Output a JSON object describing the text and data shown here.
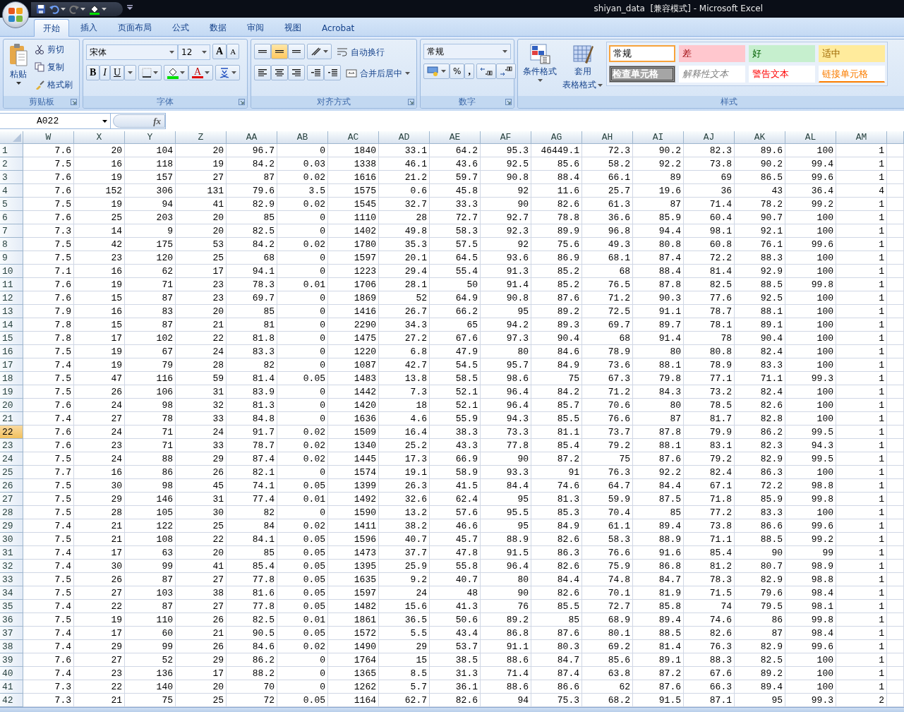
{
  "window": {
    "title": "shiyan_data  [兼容模式] - Microsoft Excel"
  },
  "ribbon_tabs": [
    {
      "label": "开始",
      "selected": true
    },
    {
      "label": "插入",
      "selected": false
    },
    {
      "label": "页面布局",
      "selected": false
    },
    {
      "label": "公式",
      "selected": false
    },
    {
      "label": "数据",
      "selected": false
    },
    {
      "label": "审阅",
      "selected": false
    },
    {
      "label": "视图",
      "selected": false
    },
    {
      "label": "Acrobat",
      "selected": false
    }
  ],
  "ribbon": {
    "clipboard": {
      "title": "剪贴板",
      "paste": "粘贴",
      "items": [
        "剪切",
        "复制",
        "格式刷"
      ]
    },
    "font": {
      "title": "字体",
      "font_name": "宋体",
      "font_size": "12",
      "grow": "A",
      "shrink": "A",
      "styles": [
        "B",
        "I",
        "U"
      ],
      "color_letter": "A"
    },
    "alignment": {
      "title": "对齐方式",
      "wrap": "自动换行",
      "merge": "合并后居中"
    },
    "number": {
      "title": "数字",
      "format": "常规",
      "percent": "%",
      "comma": ","
    },
    "styles": {
      "title": "样式",
      "conditional": "条件格式",
      "table_format": [
        "套用",
        "表格格式"
      ],
      "cell_styles": [
        {
          "label": "常规",
          "kind": "normal",
          "selected": true
        },
        {
          "label": "差",
          "kind": "bad",
          "selected": false
        },
        {
          "label": "好",
          "kind": "good",
          "selected": false
        },
        {
          "label": "适中",
          "kind": "neutral",
          "selected": false
        },
        {
          "label": "检查单元格",
          "kind": "check",
          "selected": false
        },
        {
          "label": "解释性文本",
          "kind": "explanatory",
          "selected": false
        },
        {
          "label": "警告文本",
          "kind": "warning",
          "selected": false
        },
        {
          "label": "链接单元格",
          "kind": "linked",
          "selected": false
        }
      ]
    }
  },
  "formula_bar": {
    "name_box": "A022",
    "fx": "fx"
  },
  "grid": {
    "columns": [
      "W",
      "X",
      "Y",
      "Z",
      "AA",
      "AB",
      "AC",
      "AD",
      "AE",
      "AF",
      "AG",
      "AH",
      "AI",
      "AJ",
      "AK",
      "AL",
      "AM"
    ],
    "rows": [
      {
        "header": "1",
        "selected": false,
        "cells": [
          "7.6",
          "20",
          "104",
          "20",
          "96.7",
          "0",
          "1840",
          "33.1",
          "64.2",
          "95.3",
          "46449.1",
          "72.3",
          "90.2",
          "82.3",
          "89.6",
          "100",
          "1"
        ]
      },
      {
        "header": "2",
        "selected": false,
        "cells": [
          "7.5",
          "16",
          "118",
          "19",
          "84.2",
          "0.03",
          "1338",
          "46.1",
          "43.6",
          "92.5",
          "85.6",
          "58.2",
          "92.2",
          "73.8",
          "90.2",
          "99.4",
          "1"
        ]
      },
      {
        "header": "3",
        "selected": false,
        "cells": [
          "7.6",
          "19",
          "157",
          "27",
          "87",
          "0.02",
          "1616",
          "21.2",
          "59.7",
          "90.8",
          "88.4",
          "66.1",
          "89",
          "69",
          "86.5",
          "99.6",
          "1"
        ]
      },
      {
        "header": "4",
        "selected": false,
        "cells": [
          "7.6",
          "152",
          "306",
          "131",
          "79.6",
          "3.5",
          "1575",
          "0.6",
          "45.8",
          "92",
          "11.6",
          "25.7",
          "19.6",
          "36",
          "43",
          "36.4",
          "4"
        ]
      },
      {
        "header": "5",
        "selected": false,
        "cells": [
          "7.5",
          "19",
          "94",
          "41",
          "82.9",
          "0.02",
          "1545",
          "32.7",
          "33.3",
          "90",
          "82.6",
          "61.3",
          "87",
          "71.4",
          "78.2",
          "99.2",
          "1"
        ]
      },
      {
        "header": "6",
        "selected": false,
        "cells": [
          "7.6",
          "25",
          "203",
          "20",
          "85",
          "0",
          "1110",
          "28",
          "72.7",
          "92.7",
          "78.8",
          "36.6",
          "85.9",
          "60.4",
          "90.7",
          "100",
          "1"
        ]
      },
      {
        "header": "7",
        "selected": false,
        "cells": [
          "7.3",
          "14",
          "9",
          "20",
          "82.5",
          "0",
          "1402",
          "49.8",
          "58.3",
          "92.3",
          "89.9",
          "96.8",
          "94.4",
          "98.1",
          "92.1",
          "100",
          "1"
        ]
      },
      {
        "header": "8",
        "selected": false,
        "cells": [
          "7.5",
          "42",
          "175",
          "53",
          "84.2",
          "0.02",
          "1780",
          "35.3",
          "57.5",
          "92",
          "75.6",
          "49.3",
          "80.8",
          "60.8",
          "76.1",
          "99.6",
          "1"
        ]
      },
      {
        "header": "9",
        "selected": false,
        "cells": [
          "7.5",
          "23",
          "120",
          "25",
          "68",
          "0",
          "1597",
          "20.1",
          "64.5",
          "93.6",
          "86.9",
          "68.1",
          "87.4",
          "72.2",
          "88.3",
          "100",
          "1"
        ]
      },
      {
        "header": "10",
        "selected": false,
        "cells": [
          "7.1",
          "16",
          "62",
          "17",
          "94.1",
          "0",
          "1223",
          "29.4",
          "55.4",
          "91.3",
          "85.2",
          "68",
          "88.4",
          "81.4",
          "92.9",
          "100",
          "1"
        ]
      },
      {
        "header": "11",
        "selected": false,
        "cells": [
          "7.6",
          "19",
          "71",
          "23",
          "78.3",
          "0.01",
          "1706",
          "28.1",
          "50",
          "91.4",
          "85.2",
          "76.5",
          "87.8",
          "82.5",
          "88.5",
          "99.8",
          "1"
        ]
      },
      {
        "header": "12",
        "selected": false,
        "cells": [
          "7.6",
          "15",
          "87",
          "23",
          "69.7",
          "0",
          "1869",
          "52",
          "64.9",
          "90.8",
          "87.6",
          "71.2",
          "90.3",
          "77.6",
          "92.5",
          "100",
          "1"
        ]
      },
      {
        "header": "13",
        "selected": false,
        "cells": [
          "7.9",
          "16",
          "83",
          "20",
          "85",
          "0",
          "1416",
          "26.7",
          "66.2",
          "95",
          "89.2",
          "72.5",
          "91.1",
          "78.7",
          "88.1",
          "100",
          "1"
        ]
      },
      {
        "header": "14",
        "selected": false,
        "cells": [
          "7.8",
          "15",
          "87",
          "21",
          "81",
          "0",
          "2290",
          "34.3",
          "65",
          "94.2",
          "89.3",
          "69.7",
          "89.7",
          "78.1",
          "89.1",
          "100",
          "1"
        ]
      },
      {
        "header": "15",
        "selected": false,
        "cells": [
          "7.8",
          "17",
          "102",
          "22",
          "81.8",
          "0",
          "1475",
          "27.2",
          "67.6",
          "97.3",
          "90.4",
          "68",
          "91.4",
          "78",
          "90.4",
          "100",
          "1"
        ]
      },
      {
        "header": "16",
        "selected": false,
        "cells": [
          "7.5",
          "19",
          "67",
          "24",
          "83.3",
          "0",
          "1220",
          "6.8",
          "47.9",
          "80",
          "84.6",
          "78.9",
          "80",
          "80.8",
          "82.4",
          "100",
          "1"
        ]
      },
      {
        "header": "17",
        "selected": false,
        "cells": [
          "7.4",
          "19",
          "79",
          "28",
          "82",
          "0",
          "1087",
          "42.7",
          "54.5",
          "95.7",
          "84.9",
          "73.6",
          "88.1",
          "78.9",
          "83.3",
          "100",
          "1"
        ]
      },
      {
        "header": "18",
        "selected": false,
        "cells": [
          "7.5",
          "47",
          "116",
          "59",
          "81.4",
          "0.05",
          "1483",
          "13.8",
          "58.5",
          "98.6",
          "75",
          "67.3",
          "79.8",
          "77.1",
          "71.1",
          "99.3",
          "1"
        ]
      },
      {
        "header": "19",
        "selected": false,
        "cells": [
          "7.5",
          "26",
          "106",
          "31",
          "83.9",
          "0",
          "1442",
          "7.3",
          "52.1",
          "96.4",
          "84.2",
          "71.2",
          "84.3",
          "73.2",
          "82.4",
          "100",
          "1"
        ]
      },
      {
        "header": "20",
        "selected": false,
        "cells": [
          "7.6",
          "24",
          "98",
          "32",
          "81.3",
          "0",
          "1420",
          "18",
          "52.1",
          "96.4",
          "85.7",
          "70.6",
          "80",
          "78.5",
          "82.6",
          "100",
          "1"
        ]
      },
      {
        "header": "21",
        "selected": false,
        "cells": [
          "7.4",
          "27",
          "78",
          "33",
          "84.8",
          "0",
          "1636",
          "4.6",
          "55.9",
          "94.3",
          "85.5",
          "76.6",
          "87",
          "81.7",
          "82.8",
          "100",
          "1"
        ]
      },
      {
        "header": "22",
        "selected": true,
        "cells": [
          "7.6",
          "24",
          "71",
          "24",
          "91.7",
          "0.02",
          "1509",
          "16.4",
          "38.3",
          "73.3",
          "81.1",
          "73.7",
          "87.8",
          "79.9",
          "86.2",
          "99.5",
          "1"
        ]
      },
      {
        "header": "23",
        "selected": false,
        "cells": [
          "7.6",
          "23",
          "71",
          "33",
          "78.7",
          "0.02",
          "1340",
          "25.2",
          "43.3",
          "77.8",
          "85.4",
          "79.2",
          "88.1",
          "83.1",
          "82.3",
          "94.3",
          "1"
        ]
      },
      {
        "header": "24",
        "selected": false,
        "cells": [
          "7.5",
          "24",
          "88",
          "29",
          "87.4",
          "0.02",
          "1445",
          "17.3",
          "66.9",
          "90",
          "87.2",
          "75",
          "87.6",
          "79.2",
          "82.9",
          "99.5",
          "1"
        ]
      },
      {
        "header": "25",
        "selected": false,
        "cells": [
          "7.7",
          "16",
          "86",
          "26",
          "82.1",
          "0",
          "1574",
          "19.1",
          "58.9",
          "93.3",
          "91",
          "76.3",
          "92.2",
          "82.4",
          "86.3",
          "100",
          "1"
        ]
      },
      {
        "header": "26",
        "selected": false,
        "cells": [
          "7.5",
          "30",
          "98",
          "45",
          "74.1",
          "0.05",
          "1399",
          "26.3",
          "41.5",
          "84.4",
          "74.6",
          "64.7",
          "84.4",
          "67.1",
          "72.2",
          "98.8",
          "1"
        ]
      },
      {
        "header": "27",
        "selected": false,
        "cells": [
          "7.5",
          "29",
          "146",
          "31",
          "77.4",
          "0.01",
          "1492",
          "32.6",
          "62.4",
          "95",
          "81.3",
          "59.9",
          "87.5",
          "71.8",
          "85.9",
          "99.8",
          "1"
        ]
      },
      {
        "header": "28",
        "selected": false,
        "cells": [
          "7.5",
          "28",
          "105",
          "30",
          "82",
          "0",
          "1590",
          "13.2",
          "57.6",
          "95.5",
          "85.3",
          "70.4",
          "85",
          "77.2",
          "83.3",
          "100",
          "1"
        ]
      },
      {
        "header": "29",
        "selected": false,
        "cells": [
          "7.4",
          "21",
          "122",
          "25",
          "84",
          "0.02",
          "1411",
          "38.2",
          "46.6",
          "95",
          "84.9",
          "61.1",
          "89.4",
          "73.8",
          "86.6",
          "99.6",
          "1"
        ]
      },
      {
        "header": "30",
        "selected": false,
        "cells": [
          "7.5",
          "21",
          "108",
          "22",
          "84.1",
          "0.05",
          "1596",
          "40.7",
          "45.7",
          "88.9",
          "82.6",
          "58.3",
          "88.9",
          "71.1",
          "88.5",
          "99.2",
          "1"
        ]
      },
      {
        "header": "31",
        "selected": false,
        "cells": [
          "7.4",
          "17",
          "63",
          "20",
          "85",
          "0.05",
          "1473",
          "37.7",
          "47.8",
          "91.5",
          "86.3",
          "76.6",
          "91.6",
          "85.4",
          "90",
          "99",
          "1"
        ]
      },
      {
        "header": "32",
        "selected": false,
        "cells": [
          "7.4",
          "30",
          "99",
          "41",
          "85.4",
          "0.05",
          "1395",
          "25.9",
          "55.8",
          "96.4",
          "82.6",
          "75.9",
          "86.8",
          "81.2",
          "80.7",
          "98.9",
          "1"
        ]
      },
      {
        "header": "33",
        "selected": false,
        "cells": [
          "7.5",
          "26",
          "87",
          "27",
          "77.8",
          "0.05",
          "1635",
          "9.2",
          "40.7",
          "80",
          "84.4",
          "74.8",
          "84.7",
          "78.3",
          "82.9",
          "98.8",
          "1"
        ]
      },
      {
        "header": "34",
        "selected": false,
        "cells": [
          "7.5",
          "27",
          "103",
          "38",
          "81.6",
          "0.05",
          "1597",
          "24",
          "48",
          "90",
          "82.6",
          "70.1",
          "81.9",
          "71.5",
          "79.6",
          "98.4",
          "1"
        ]
      },
      {
        "header": "35",
        "selected": false,
        "cells": [
          "7.4",
          "22",
          "87",
          "27",
          "77.8",
          "0.05",
          "1482",
          "15.6",
          "41.3",
          "76",
          "85.5",
          "72.7",
          "85.8",
          "74",
          "79.5",
          "98.1",
          "1"
        ]
      },
      {
        "header": "36",
        "selected": false,
        "cells": [
          "7.5",
          "19",
          "110",
          "26",
          "82.5",
          "0.01",
          "1861",
          "36.5",
          "50.6",
          "89.2",
          "85",
          "68.9",
          "89.4",
          "74.6",
          "86",
          "99.8",
          "1"
        ]
      },
      {
        "header": "37",
        "selected": false,
        "cells": [
          "7.4",
          "17",
          "60",
          "21",
          "90.5",
          "0.05",
          "1572",
          "5.5",
          "43.4",
          "86.8",
          "87.6",
          "80.1",
          "88.5",
          "82.6",
          "87",
          "98.4",
          "1"
        ]
      },
      {
        "header": "38",
        "selected": false,
        "cells": [
          "7.4",
          "29",
          "99",
          "26",
          "84.6",
          "0.02",
          "1490",
          "29",
          "53.7",
          "91.1",
          "80.3",
          "69.2",
          "81.4",
          "76.3",
          "82.9",
          "99.6",
          "1"
        ]
      },
      {
        "header": "39",
        "selected": false,
        "cells": [
          "7.6",
          "27",
          "52",
          "29",
          "86.2",
          "0",
          "1764",
          "15",
          "38.5",
          "88.6",
          "84.7",
          "85.6",
          "89.1",
          "88.3",
          "82.5",
          "100",
          "1"
        ]
      },
      {
        "header": "40",
        "selected": false,
        "cells": [
          "7.4",
          "23",
          "136",
          "17",
          "88.2",
          "0",
          "1365",
          "8.5",
          "31.3",
          "71.4",
          "87.4",
          "63.8",
          "87.2",
          "67.6",
          "89.2",
          "100",
          "1"
        ]
      },
      {
        "header": "41",
        "selected": false,
        "cells": [
          "7.3",
          "22",
          "140",
          "20",
          "70",
          "0",
          "1262",
          "5.7",
          "36.1",
          "88.6",
          "86.6",
          "62",
          "87.6",
          "66.3",
          "89.4",
          "100",
          "1"
        ]
      },
      {
        "header": "42",
        "selected": false,
        "cells": [
          "7.3",
          "21",
          "75",
          "25",
          "72",
          "0.05",
          "1164",
          "62.7",
          "82.6",
          "94",
          "75.3",
          "68.2",
          "91.5",
          "87.1",
          "95",
          "99.3",
          "2"
        ]
      }
    ]
  }
}
